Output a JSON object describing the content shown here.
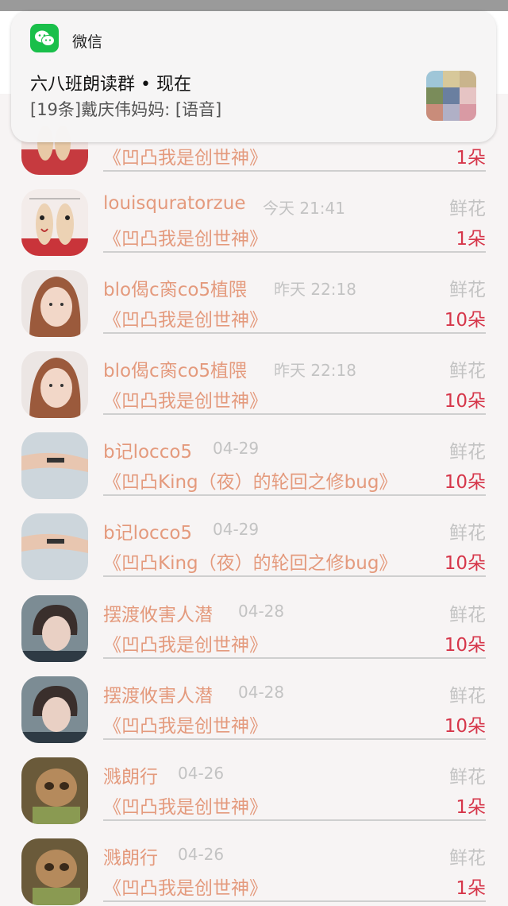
{
  "notification": {
    "app_name": "微信",
    "title": "六八班朗读群 • 现在",
    "body": "[19条]戴庆伟妈妈: [语音]",
    "app_icon": "wechat-icon",
    "thumbnail": "group-avatar-grid"
  },
  "rows": [
    {
      "name": "",
      "time": "",
      "type": "",
      "work": "《凹凸我是创世神》",
      "amount": "1朵"
    },
    {
      "name": "louisquratorzue",
      "time": "今天 21:41",
      "type": "鲜花",
      "work": "《凹凸我是创世神》",
      "amount": "1朵"
    },
    {
      "name": "blo偈c脔co5植隈",
      "time": "昨天 22:18",
      "type": "鲜花",
      "work": "《凹凸我是创世神》",
      "amount": "10朵"
    },
    {
      "name": "blo偈c脔co5植隈",
      "time": "昨天 22:18",
      "type": "鲜花",
      "work": "《凹凸我是创世神》",
      "amount": "10朵"
    },
    {
      "name": "b记locco5",
      "time": "04-29",
      "type": "鲜花",
      "work": "《凹凸King（夜）的轮回之修bug》",
      "amount": "10朵"
    },
    {
      "name": "b记locco5",
      "time": "04-29",
      "type": "鲜花",
      "work": "《凹凸King（夜）的轮回之修bug》",
      "amount": "10朵"
    },
    {
      "name": "摆渡攸害人潜",
      "time": "04-28",
      "type": "鲜花",
      "work": "《凹凸我是创世神》",
      "amount": "10朵"
    },
    {
      "name": "摆渡攸害人潜",
      "time": "04-28",
      "type": "鲜花",
      "work": "《凹凸我是创世神》",
      "amount": "10朵"
    },
    {
      "name": "溅朗行",
      "time": "04-26",
      "type": "鲜花",
      "work": "《凹凸我是创世神》",
      "amount": "1朵"
    },
    {
      "name": "溅朗行",
      "time": "04-26",
      "type": "鲜花",
      "work": "《凹凸我是创世神》",
      "amount": "1朵"
    }
  ],
  "colors": {
    "name": "#e49a7d",
    "meta": "#c3c3c3",
    "amount": "#d6364a",
    "wechat_green": "#19bf4a"
  }
}
